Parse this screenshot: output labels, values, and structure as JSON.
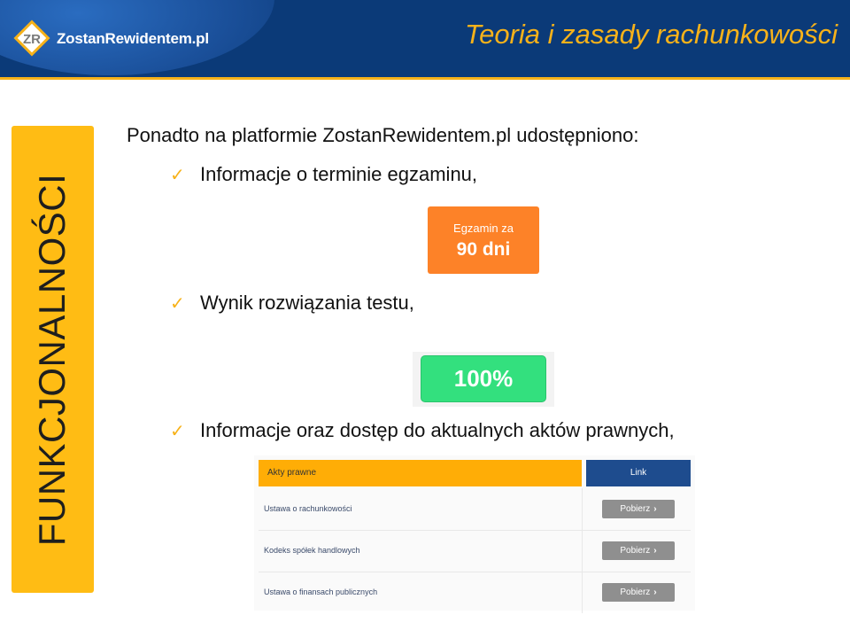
{
  "header": {
    "logo_text": "ZostanRewidentem.pl",
    "title": "Teoria i zasady rachunkowości"
  },
  "side_label": "FUNKCJONALNOŚCI",
  "intro": "Ponadto na platformie ZostanRewidentem.pl udostępniono:",
  "bullets": [
    "Informacje o terminie egzaminu,",
    "Wynik rozwiązania testu,",
    "Informacje oraz dostęp do aktualnych aktów prawnych,"
  ],
  "exam_widget": {
    "line1": "Egzamin za",
    "line2": "90 dni"
  },
  "result_widget": {
    "value": "100%"
  },
  "acts_table": {
    "header_acts": "Akty prawne",
    "header_link": "Link",
    "rows": [
      {
        "name": "Ustawa o rachunkowości",
        "button": "Pobierz"
      },
      {
        "name": "Kodeks spółek handlowych",
        "button": "Pobierz"
      },
      {
        "name": "Ustawa o finansach publicznych",
        "button": "Pobierz"
      }
    ]
  },
  "colors": {
    "header_blue": "#0b3a78",
    "gold": "#f7b21a",
    "side_bar": "#ffbc14",
    "exam_orange": "#fd8228",
    "result_green": "#33e07e",
    "link_header_blue": "#1e4c8e",
    "button_gray": "#8f8f8f"
  },
  "icons": [
    "zr-logo-icon",
    "checkmark-icon",
    "chevron-right-icon"
  ]
}
